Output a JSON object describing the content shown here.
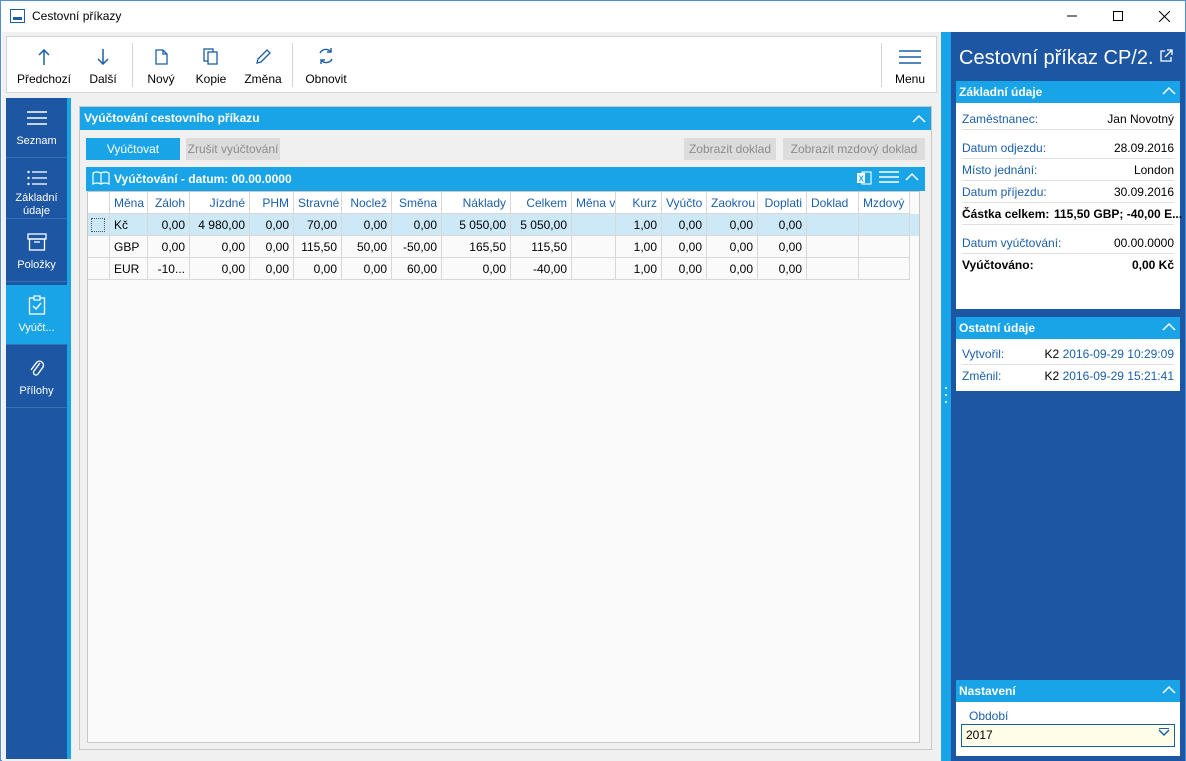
{
  "window": {
    "title": "Cestovní příkazy"
  },
  "toolbar": {
    "prev_label": "Předchozí",
    "next_label": "Další",
    "new_label": "Nový",
    "copy_label": "Kopie",
    "edit_label": "Změna",
    "refresh_label": "Obnovit",
    "menu_label": "Menu"
  },
  "leftnav": {
    "items": [
      {
        "label": "Seznam",
        "icon": "list-lines-icon"
      },
      {
        "label": "Základní údaje",
        "icon": "list-bullets-icon"
      },
      {
        "label": "Položky",
        "icon": "box-icon"
      },
      {
        "label": "Vyúčt...",
        "icon": "clipboard-check-icon"
      },
      {
        "label": "Přílohy",
        "icon": "paperclip-icon"
      }
    ],
    "active_index": 3
  },
  "main": {
    "panel_title": "Vyúčtování cestovního příkazu",
    "buttons": {
      "settle": "Vyúčtovat",
      "cancel_settle": "Zrušit vyúčtování",
      "show_doc": "Zobrazit doklad",
      "show_payroll_doc": "Zobrazit mzdový doklad"
    },
    "grid_title": "Vyúčtování - datum: 00.00.0000",
    "columns": [
      "Měna",
      "Záloh",
      "Jízdné",
      "PHM",
      "Stravné",
      "Noclež",
      "Směna",
      "Náklady",
      "Celkem",
      "Měna v",
      "Kurz",
      "Vyúčto",
      "Zaokrou",
      "Doplati",
      "Doklad",
      "Mzdový"
    ],
    "rows": [
      [
        "Kč",
        "0,00",
        "4 980,00",
        "0,00",
        "70,00",
        "0,00",
        "0,00",
        "5 050,00",
        "5 050,00",
        "",
        "1,00",
        "0,00",
        "0,00",
        "0,00",
        "",
        ""
      ],
      [
        "GBP",
        "0,00",
        "0,00",
        "0,00",
        "115,50",
        "50,00",
        "-50,00",
        "165,50",
        "115,50",
        "",
        "1,00",
        "0,00",
        "0,00",
        "0,00",
        "",
        ""
      ],
      [
        "EUR",
        "-10...",
        "0,00",
        "0,00",
        "0,00",
        "0,00",
        "60,00",
        "0,00",
        "-40,00",
        "",
        "1,00",
        "0,00",
        "0,00",
        "0,00",
        "",
        ""
      ]
    ],
    "selected_row": 0
  },
  "right": {
    "title": "Cestovní příkaz CP/2...",
    "basic": {
      "header": "Základní údaje",
      "employee_label": "Zaměstnanec:",
      "employee_value": "Jan Novotný",
      "departure_label": "Datum odjezdu:",
      "departure_value": "28.09.2016",
      "place_label": "Místo jednání:",
      "place_value": "London",
      "arrival_label": "Datum příjezdu:",
      "arrival_value": "30.09.2016",
      "total_label": "Částka celkem:",
      "total_value": "115,50 GBP; -40,00 E...",
      "settle_date_label": "Datum vyúčtování:",
      "settle_date_value": "00.00.0000",
      "settled_label": "Vyúčtováno:",
      "settled_value": "0,00 Kč"
    },
    "other": {
      "header": "Ostatní údaje",
      "created_label": "Vytvořil:",
      "created_user": "K2",
      "created_ts": "2016-09-29 10:29:09",
      "changed_label": "Změnil:",
      "changed_user": "K2",
      "changed_ts": "2016-09-29 15:21:41"
    },
    "settings": {
      "header": "Nastavení",
      "period_label": "Období",
      "period_value": "2017"
    }
  },
  "colors": {
    "accent": "#19a4e8",
    "nav": "#1d56a3",
    "link": "#1b5fa8"
  }
}
